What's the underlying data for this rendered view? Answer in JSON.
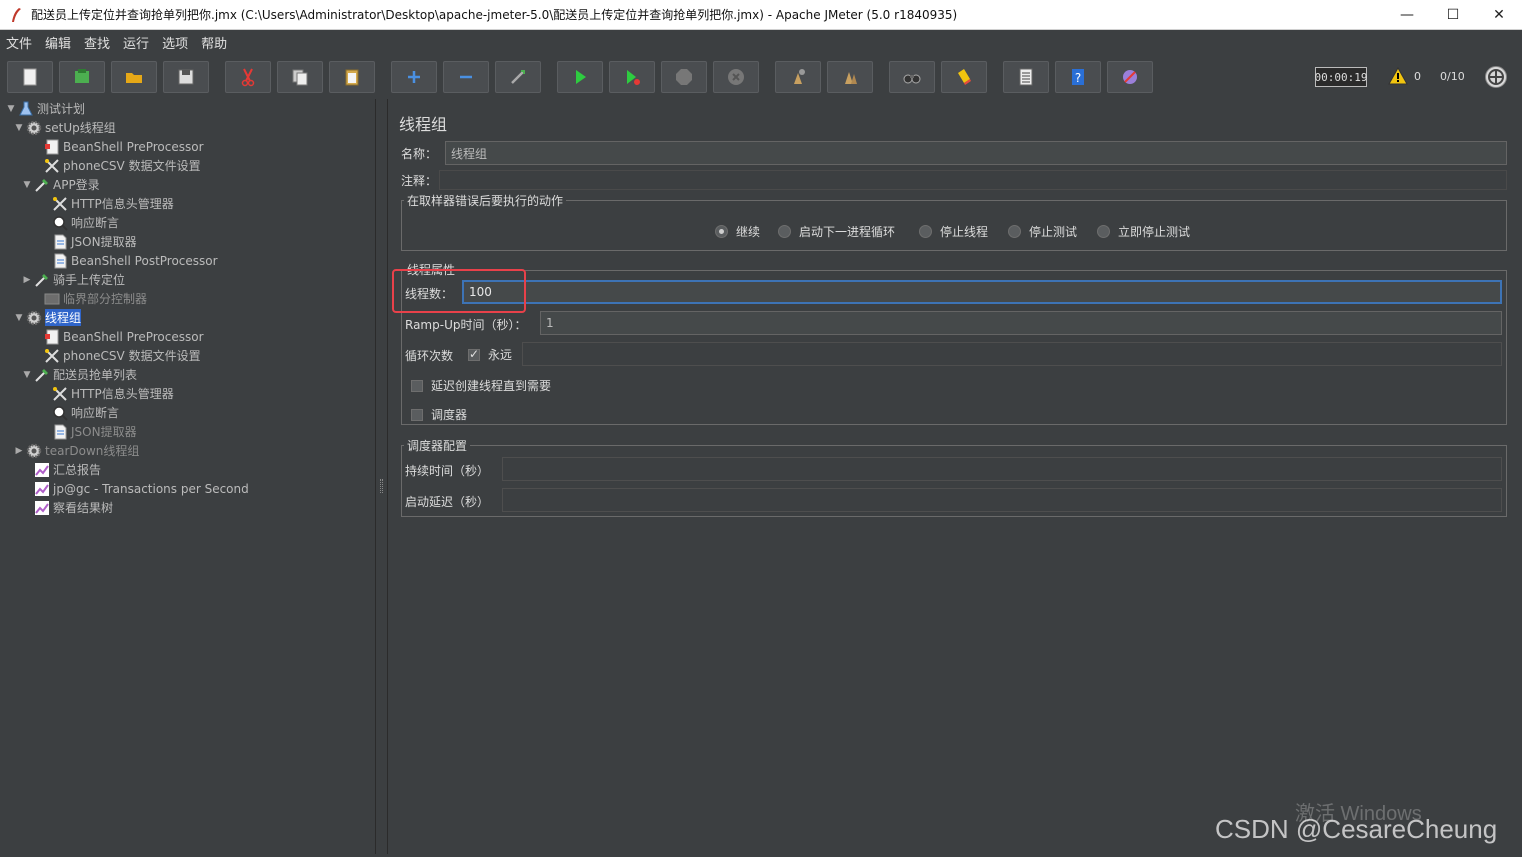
{
  "window": {
    "title": "配送员上传定位并查询抢单列把你.jmx (C:\\Users\\Administrator\\Desktop\\apache-jmeter-5.0\\配送员上传定位并查询抢单列把你.jmx) - Apache JMeter (5.0 r1840935)",
    "minimize": "—",
    "maximize": "☐",
    "close": "✕"
  },
  "menu": [
    "文件",
    "编辑",
    "查找",
    "运行",
    "选项",
    "帮助"
  ],
  "toolbar": {
    "buttons": [
      "new",
      "templates",
      "open",
      "save",
      "cut",
      "copy",
      "paste",
      "expand",
      "collapse",
      "toggle",
      "start",
      "start-no-pause",
      "stop",
      "shutdown",
      "clear",
      "clear-all",
      "search",
      "reset-search",
      "function-helper",
      "help",
      "remote"
    ],
    "timer": "00:00:19",
    "warnings": "0",
    "threads": "0/10"
  },
  "tree": [
    {
      "label": "测试计划",
      "icon": "flask-icon",
      "toggle": "▼"
    },
    {
      "label": "setUp线程组",
      "icon": "gear-icon",
      "toggle": "▼"
    },
    {
      "label": "BeanShell PreProcessor",
      "icon": "script-icon",
      "toggle": ""
    },
    {
      "label": "phoneCSV 数据文件设置",
      "icon": "tools-icon",
      "toggle": ""
    },
    {
      "label": "APP登录",
      "icon": "dropper-icon",
      "toggle": "▼"
    },
    {
      "label": "HTTP信息头管理器",
      "icon": "tools-icon",
      "toggle": ""
    },
    {
      "label": "响应断言",
      "icon": "magnifier-icon",
      "toggle": ""
    },
    {
      "label": "JSON提取器",
      "icon": "doc-icon",
      "toggle": ""
    },
    {
      "label": "BeanShell PostProcessor",
      "icon": "doc-icon",
      "toggle": ""
    },
    {
      "label": "骑手上传定位",
      "icon": "dropper-icon",
      "toggle": "▶"
    },
    {
      "label": "临界部分控制器",
      "icon": "controller-icon",
      "toggle": ""
    },
    {
      "label": "线程组",
      "icon": "gear-icon",
      "toggle": "▼"
    },
    {
      "label": "BeanShell PreProcessor",
      "icon": "script-icon",
      "toggle": ""
    },
    {
      "label": "phoneCSV 数据文件设置",
      "icon": "tools-icon",
      "toggle": ""
    },
    {
      "label": "配送员抢单列表",
      "icon": "dropper-icon",
      "toggle": "▼"
    },
    {
      "label": "HTTP信息头管理器",
      "icon": "tools-icon",
      "toggle": ""
    },
    {
      "label": "响应断言",
      "icon": "magnifier-icon",
      "toggle": ""
    },
    {
      "label": "JSON提取器",
      "icon": "doc-icon",
      "toggle": ""
    },
    {
      "label": "tearDown线程组",
      "icon": "gear-icon",
      "toggle": "▶"
    },
    {
      "label": "汇总报告",
      "icon": "chart-icon",
      "toggle": ""
    },
    {
      "label": "jp@gc - Transactions per Second",
      "icon": "chart-icon",
      "toggle": ""
    },
    {
      "label": "察看结果树",
      "icon": "chart-icon",
      "toggle": ""
    }
  ],
  "panel": {
    "title": "线程组",
    "name_label": "名称：",
    "name_value": "线程组",
    "comment_label": "注释：",
    "comment_value": "",
    "error_group_title": "在取样器错误后要执行的动作",
    "error_actions": [
      "继续",
      "启动下一进程循环",
      "停止线程",
      "停止测试",
      "立即停止测试"
    ],
    "error_action_selected": "继续",
    "props_group_title": "线程属性",
    "threads_label": "线程数：",
    "threads_value": "100",
    "rampup_label": "Ramp-Up时间（秒）：",
    "rampup_value": "1",
    "loop_label": "循环次数",
    "forever_label": "永远",
    "forever_checked": true,
    "loop_value": "",
    "delay_label": "延迟创建线程直到需要",
    "delay_checked": false,
    "scheduler_label": "调度器",
    "scheduler_checked": false,
    "scheduler_group_title": "调度器配置",
    "duration_label": "持续时间（秒）",
    "duration_value": "",
    "startup_label": "启动延迟（秒）",
    "startup_value": ""
  },
  "watermark": {
    "activate": "激活 Windows",
    "csdn": "CSDN @CesareCheung"
  },
  "colors": {
    "background": "#3c3f41",
    "selection": "#2f65ca",
    "highlight": "#e8414a",
    "focus": "#3d73b5"
  }
}
